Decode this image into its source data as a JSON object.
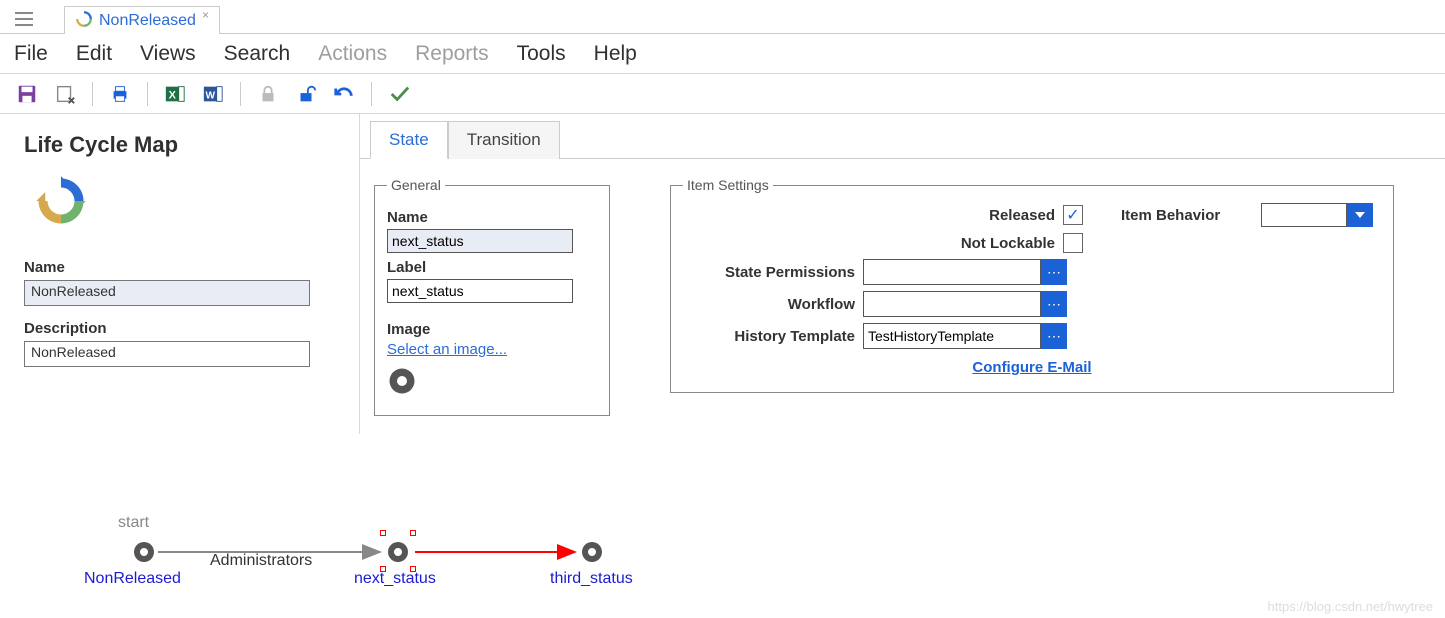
{
  "tab": {
    "title": "NonReleased"
  },
  "menus": [
    "File",
    "Edit",
    "Views",
    "Search",
    "Actions",
    "Reports",
    "Tools",
    "Help"
  ],
  "menus_disabled": [
    "Actions",
    "Reports"
  ],
  "left": {
    "title": "Life Cycle Map",
    "name_label": "Name",
    "name_value": "NonReleased",
    "desc_label": "Description",
    "desc_value": "NonReleased"
  },
  "rtabs": {
    "state": "State",
    "transition": "Transition"
  },
  "general": {
    "legend": "General",
    "name_label": "Name",
    "name_value": "next_status",
    "label_label": "Label",
    "label_value": "next_status",
    "image_label": "Image",
    "image_link": "Select an image..."
  },
  "settings": {
    "legend": "Item Settings",
    "released_label": "Released",
    "released_checked": true,
    "not_lockable_label": "Not Lockable",
    "not_lockable_checked": false,
    "state_perm_label": "State Permissions",
    "state_perm_value": "",
    "workflow_label": "Workflow",
    "workflow_value": "",
    "history_label": "History Template",
    "history_value": "TestHistoryTemplate",
    "item_behavior_label": "Item Behavior",
    "item_behavior_value": "",
    "configure_email": "Configure E-Mail"
  },
  "diagram": {
    "start_label": "start",
    "n1": "NonReleased",
    "edge1": "Administrators",
    "n2": "next_status",
    "n3": "third_status"
  },
  "watermark": "https://blog.csdn.net/hwytree"
}
